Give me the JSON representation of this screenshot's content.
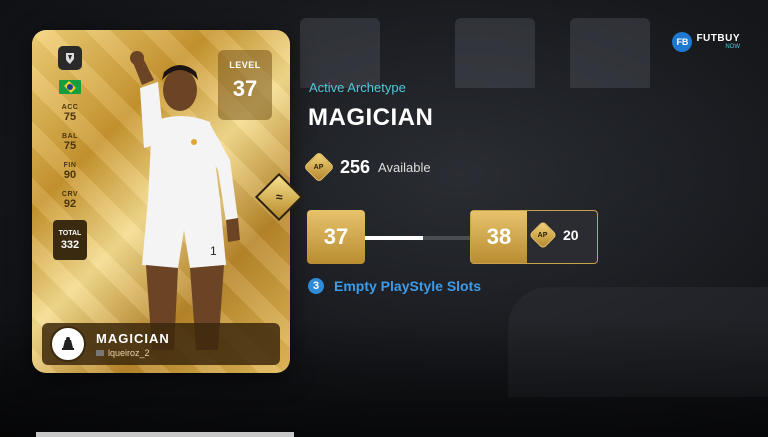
{
  "card": {
    "level_label": "LEVEL",
    "level_value": "37",
    "stats": [
      {
        "label": "ACC",
        "value": "75"
      },
      {
        "label": "BAL",
        "value": "75"
      },
      {
        "label": "FIN",
        "value": "90"
      },
      {
        "label": "CRV",
        "value": "92"
      }
    ],
    "total_label": "TOTAL",
    "total_value": "332",
    "archetype_name": "MAGICIAN",
    "username": "lqueiroz_2",
    "nation": "Brazil",
    "club_icon": "club-badge-icon"
  },
  "panel": {
    "active_label": "Active Archetype",
    "archetype_name": "MAGICIAN",
    "ap_icon_label": "AP",
    "ap_available_value": "256",
    "ap_available_label": "Available",
    "current_level": "37",
    "next_level": "38",
    "next_level_cost": "20",
    "level_progress": 0.55,
    "slots_count": "3",
    "slots_label": "Empty PlayStyle Slots"
  },
  "brand": {
    "icon_text": "FB",
    "name": "FUTBUY",
    "sub": "NOW"
  },
  "colors": {
    "accent_cyan": "#4fc9d9",
    "accent_blue": "#3d9be8",
    "gold": "#e7c36c"
  }
}
